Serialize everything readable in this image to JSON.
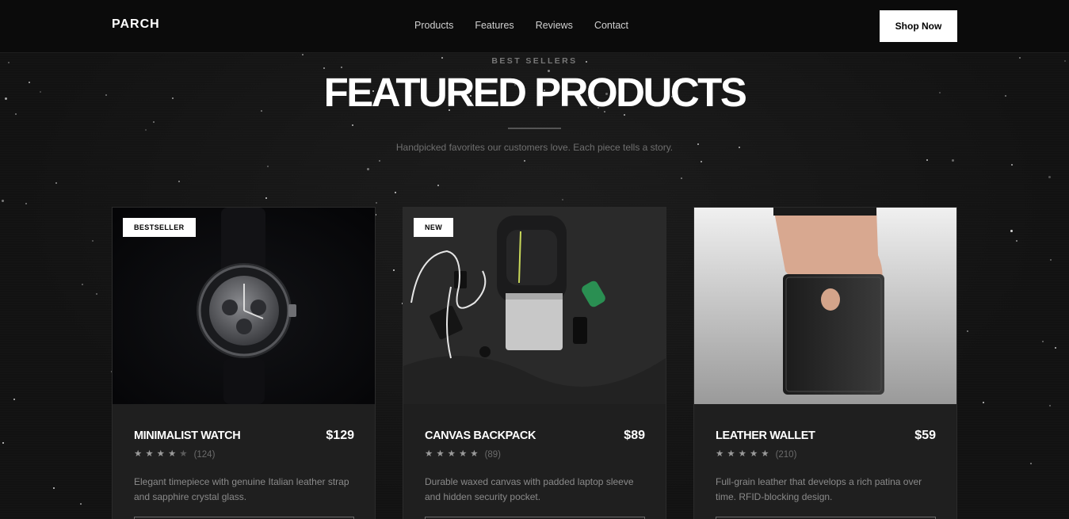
{
  "header": {
    "logo": "PARCH",
    "nav": [
      "Products",
      "Features",
      "Reviews",
      "Contact"
    ],
    "cta": "Shop Now"
  },
  "section": {
    "eyebrow": "BEST SELLERS",
    "title": "FEATURED PRODUCTS",
    "subtitle": "Handpicked favorites our customers love. Each piece tells a story."
  },
  "products": [
    {
      "badge": "BESTSELLER",
      "name": "MINIMALIST WATCH",
      "price": "$129",
      "rating": 4.5,
      "reviews": "(124)",
      "description": "Elegant timepiece with genuine Italian leather strap and sapphire crystal glass.",
      "image": "watch-photo"
    },
    {
      "badge": "NEW",
      "name": "CANVAS BACKPACK",
      "price": "$89",
      "rating": 5,
      "reviews": "(89)",
      "description": "Durable waxed canvas with padded laptop sleeve and hidden security pocket.",
      "image": "backpack-flatlay-photo"
    },
    {
      "badge": "",
      "name": "LEATHER WALLET",
      "price": "$59",
      "rating": 5,
      "reviews": "(210)",
      "description": "Full-grain leather that develops a rich patina over time. RFID-blocking design.",
      "image": "wallet-in-hand-photo"
    }
  ],
  "colors": {
    "background": "#141414",
    "card": "#1f1f1f",
    "accent": "#ffffff",
    "muted": "#8a8a8a"
  }
}
